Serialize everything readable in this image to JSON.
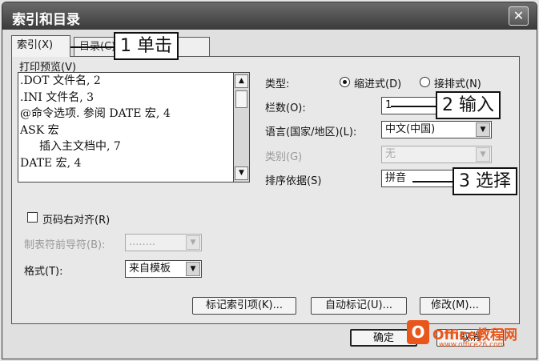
{
  "window": {
    "title": "索引和目录",
    "close_glyph": "✕"
  },
  "tabs": [
    {
      "label": "索引(X)"
    },
    {
      "label": "目录(C)"
    }
  ],
  "preview": {
    "label": "打印预览(V)",
    "lines": [
      ".DOT 文件名, 2",
      ".INI 文件名, 3",
      "@命令选项. 参阅 DATE 宏, 4",
      "ASK 宏",
      "插入主文档中, 7",
      "DATE 宏, 4"
    ]
  },
  "type": {
    "label": "类型:",
    "options": [
      "缩进式(D)",
      "接排式(N)"
    ],
    "selected": 0
  },
  "columns": {
    "label": "栏数(O):",
    "value": "1"
  },
  "language": {
    "label": "语言(国家/地区)(L):",
    "value": "中文(中国)"
  },
  "category": {
    "label": "类别(G)",
    "value": "无"
  },
  "sort": {
    "label": "排序依据(S)",
    "value": "拼音"
  },
  "right_align": {
    "label": "页码右对齐(R)",
    "checked": false
  },
  "leader": {
    "label": "制表符前导符(B):",
    "value": "........"
  },
  "format": {
    "label": "格式(T):",
    "value": "来自模板"
  },
  "buttons": {
    "mark_entry": "标记索引项(K)...",
    "automark": "自动标记(U)...",
    "modify": "修改(M)...",
    "ok": "确定",
    "cancel": "取消"
  },
  "callouts": {
    "step1": "1 单击",
    "step2": "2 输入",
    "step3": "3 选择"
  },
  "watermark": {
    "name": "Office教程网",
    "url": "www.office26.com"
  }
}
